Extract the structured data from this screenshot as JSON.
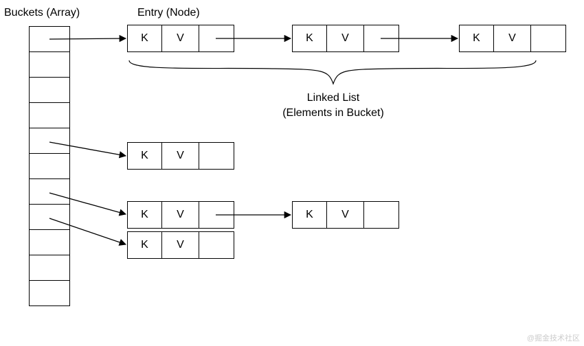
{
  "labels": {
    "buckets": "Buckets (Array)",
    "entry": "Entry (Node)",
    "linked_list_line1": "Linked List",
    "linked_list_line2": "(Elements in Bucket)"
  },
  "cell": {
    "key": "K",
    "value": "V"
  },
  "watermark": "@掘金技术社区",
  "diagram": {
    "bucket_count": 11,
    "rows": [
      {
        "bucket_index": 0,
        "nodes": 3
      },
      {
        "bucket_index": 4,
        "nodes": 1
      },
      {
        "bucket_index": 6,
        "nodes": 2
      },
      {
        "bucket_index": 7,
        "nodes": 1
      }
    ]
  }
}
